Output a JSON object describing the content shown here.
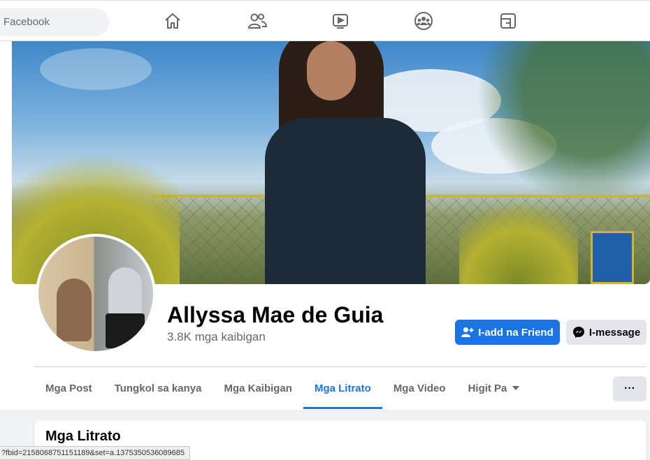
{
  "topbar": {
    "search_label": "Facebook",
    "nav_icons": [
      "home-icon",
      "friends-icon",
      "watch-icon",
      "groups-icon",
      "gaming-icon"
    ]
  },
  "profile": {
    "name": "Allyssa Mae de Guia",
    "friends_count": "3.8K mga kaibigan",
    "add_friend_label": "I-add na Friend",
    "message_label": "I-message"
  },
  "tabs": [
    {
      "label": "Mga Post",
      "active": false
    },
    {
      "label": "Tungkol sa kanya",
      "active": false
    },
    {
      "label": "Mga Kaibigan",
      "active": false
    },
    {
      "label": "Mga Litrato",
      "active": true
    },
    {
      "label": "Mga Video",
      "active": false
    },
    {
      "label": "Higit Pa",
      "active": false
    }
  ],
  "more_button_label": "···",
  "photos_section": {
    "title": "Mga Litrato"
  },
  "status_bar": {
    "url": "?fbid=2158068751151189&set=a.1375350536089685"
  },
  "colors": {
    "accent": "#1b74e4",
    "secondary_button": "#e4e6eb",
    "background": "#f0f2f5",
    "muted_text": "#65676b"
  }
}
